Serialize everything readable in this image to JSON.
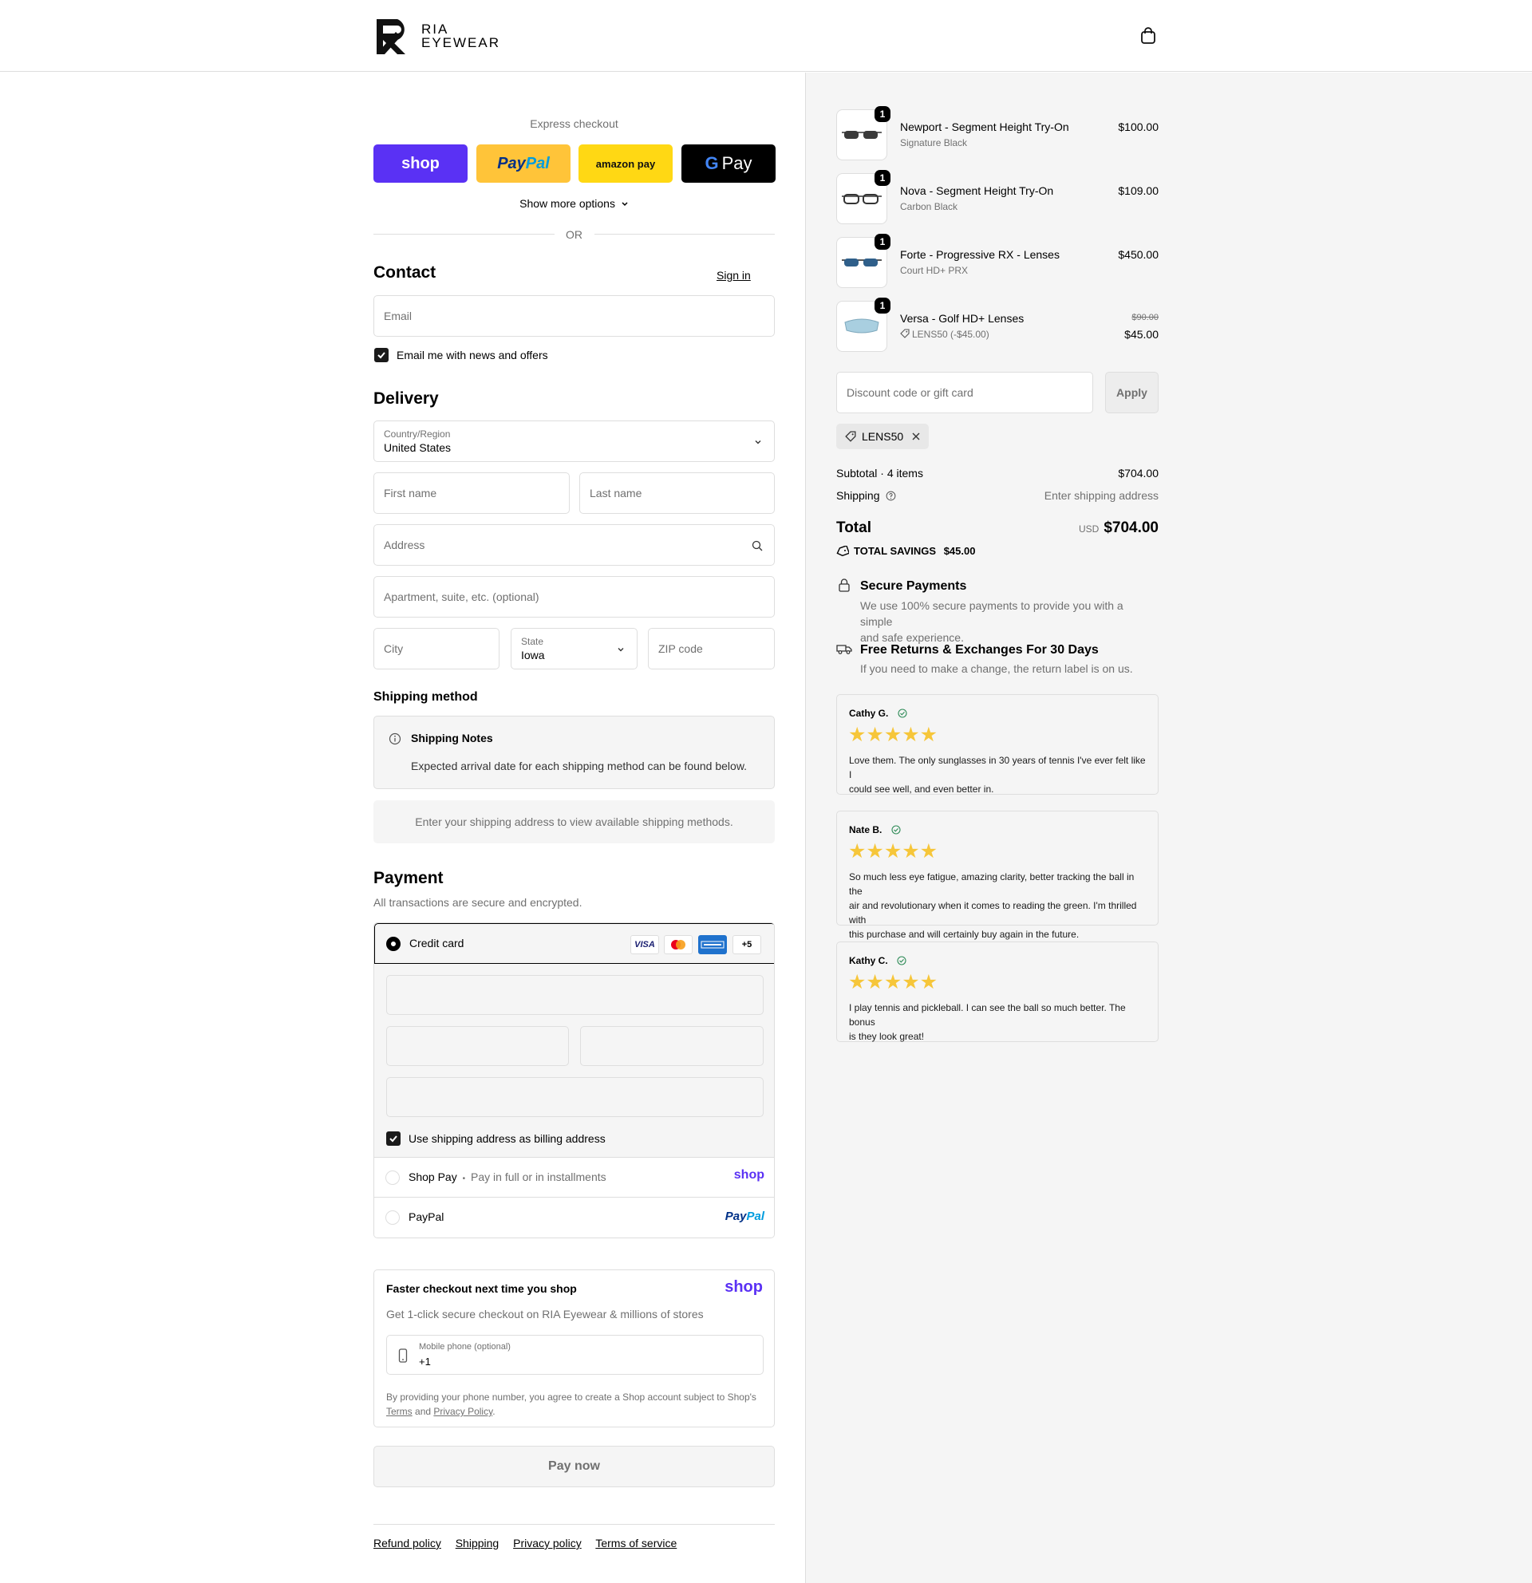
{
  "header": {
    "logo_top": "RIA",
    "logo_bottom": "EYEWEAR",
    "cart_icon": "shopping-bag-icon"
  },
  "express": {
    "title": "Express checkout",
    "buttons": {
      "shop": "shop",
      "paypal_a": "Pay",
      "paypal_b": "Pal",
      "amazon": "amazon pay",
      "gpay": "Pay"
    },
    "more_options": "Show more options",
    "or": "OR"
  },
  "contact": {
    "heading": "Contact",
    "sign_in": "Sign in",
    "email_placeholder": "Email",
    "newsletter_label": "Email me with news and offers"
  },
  "delivery": {
    "heading": "Delivery",
    "country_label": "Country/Region",
    "country_value": "United States",
    "first_name": "First name",
    "last_name": "Last name",
    "address": "Address",
    "apartment": "Apartment, suite, etc. (optional)",
    "city": "City",
    "state_label": "State",
    "state_value": "Iowa",
    "zip": "ZIP code"
  },
  "shipping_method": {
    "heading": "Shipping method",
    "notes_title": "Shipping Notes",
    "notes_text": "Expected arrival date for each shipping method can be found below.",
    "info": "Enter your shipping address to view available shipping methods."
  },
  "payment": {
    "heading": "Payment",
    "subheading": "All transactions are secure and encrypted.",
    "credit_card": "Credit card",
    "cards": [
      "VISA",
      "+5"
    ],
    "billing_label": "Use shipping address as billing address",
    "shop_pay": "Shop Pay",
    "shop_pay_dot": "•",
    "shop_pay_sub": "Pay in full or in installments",
    "shop_pay_logo": "shop",
    "paypal": "PayPal",
    "paypal_logo_a": "Pay",
    "paypal_logo_b": "Pal"
  },
  "shop_promo": {
    "title": "Faster checkout next time you shop",
    "logo": "shop",
    "subtitle": "Get 1-click secure checkout on RIA Eyewear & millions of stores",
    "phone_label": "Mobile phone (optional)",
    "phone_value": "+1",
    "legal_1": "By providing your phone number, you agree to create a Shop account subject to Shop's",
    "legal_terms": "Terms",
    "legal_and": "and",
    "legal_privacy": "Privacy Policy",
    "legal_end": "."
  },
  "pay_now": "Pay now",
  "footer": [
    "Refund policy",
    "Shipping",
    "Privacy policy",
    "Terms of service"
  ],
  "order": {
    "items": [
      {
        "qty": "1",
        "name": "Newport - Segment Height Try-On",
        "variant": "Signature Black",
        "price": "$100.00"
      },
      {
        "qty": "1",
        "name": "Nova - Segment Height Try-On",
        "variant": "Carbon Black",
        "price": "$109.00"
      },
      {
        "qty": "1",
        "name": "Forte - Progressive RX - Lenses",
        "variant": "Court HD+ PRX",
        "price": "$450.00"
      },
      {
        "qty": "1",
        "name": "Versa - Golf HD+ Lenses",
        "variant": "LENS50 (-$45.00)",
        "old_price": "$90.00",
        "price": "$45.00"
      }
    ],
    "discount_placeholder": "Discount code or gift card",
    "apply": "Apply",
    "code": "LENS50",
    "subtotal_label": "Subtotal · 4 items",
    "subtotal": "$704.00",
    "shipping_label": "Shipping",
    "shipping_value": "Enter shipping address",
    "total_label": "Total",
    "currency": "USD",
    "total": "$704.00",
    "savings_label": "TOTAL SAVINGS",
    "savings": "$45.00"
  },
  "trust": {
    "secure_title": "Secure Payments",
    "secure_text_1": "We use 100% secure payments to provide you with a simple",
    "secure_text_2": "and safe experience.",
    "returns_title": "Free Returns & Exchanges For 30 Days",
    "returns_text": "If you need to make a change, the return label is on us."
  },
  "reviews": [
    {
      "name": "Cathy G.",
      "stars": "★★★★★",
      "lines": [
        "Love them. The only sunglasses in 30 years of tennis I've ever felt like I",
        "could see well, and even better in."
      ]
    },
    {
      "name": "Nate B.",
      "stars": "★★★★★",
      "lines": [
        "So much less eye fatigue, amazing clarity, better tracking the ball in the",
        "air and revolutionary when it comes to reading the green. I'm thrilled with",
        "this purchase and will certainly buy again in the future."
      ]
    },
    {
      "name": "Kathy C.",
      "stars": "★★★★★",
      "lines": [
        "I play tennis and pickleball. I can see the ball so much better. The bonus",
        "is they look great!"
      ]
    }
  ],
  "colors": {
    "shop_purple": "#5a31f4",
    "paypal_yellow": "#ffc439",
    "amazon_yellow": "#ffd814",
    "star_yellow": "#f6c63a",
    "verified_green": "#2e8b57"
  }
}
